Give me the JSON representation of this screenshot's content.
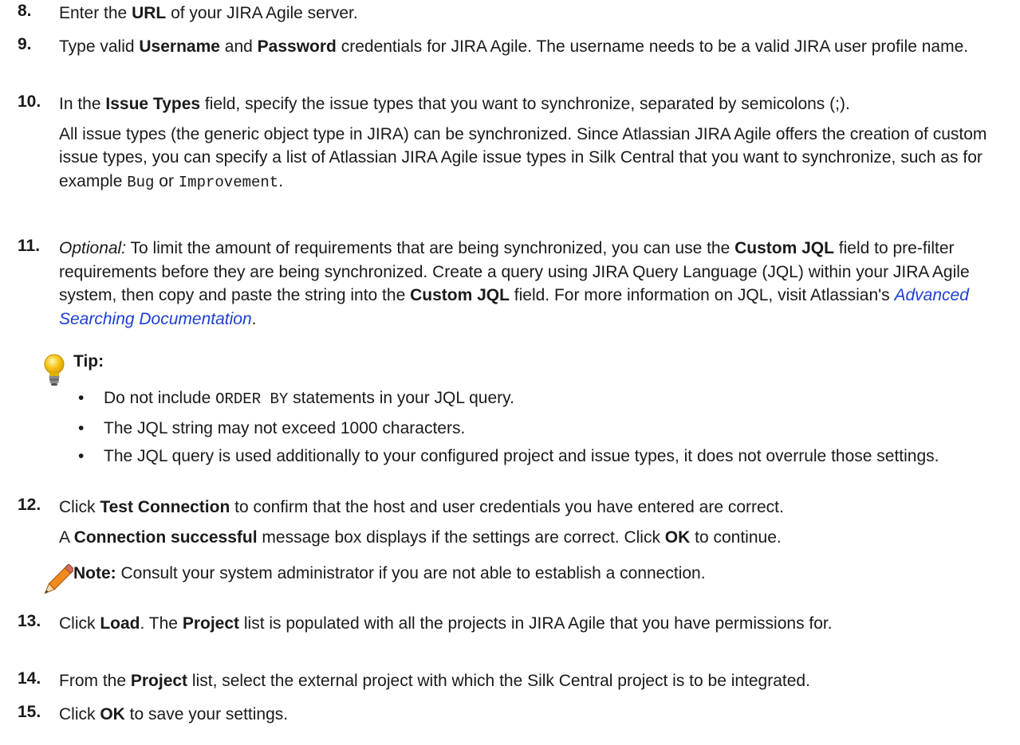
{
  "steps": {
    "s8": {
      "num": "8.",
      "t1": "Enter the ",
      "b1": "URL",
      "t2": " of your JIRA Agile server."
    },
    "s9": {
      "num": "9.",
      "t1": "Type valid ",
      "b1": "Username",
      "t2": " and ",
      "b2": "Password",
      "t3": " credentials for JIRA Agile. The username needs to be a valid JIRA user profile name."
    },
    "s10": {
      "num": "10.",
      "t1": "In the ",
      "b1": "Issue Types",
      "t2": " field, specify the issue types that you want to synchronize, separated by semicolons (;).",
      "p1": "All issue types (the generic object type in JIRA) can be synchronized. Since Atlassian JIRA Agile offers the creation of custom issue types, you can specify a list of Atlassian JIRA Agile issue types in Silk Central that you want to synchronize, such as for example ",
      "c1": "Bug",
      "p2": " or ",
      "c2": "Improvement",
      "p3": "."
    },
    "s11": {
      "num": "11.",
      "i1": "Optional:",
      "t1": " To limit the amount of requirements that are being synchronized, you can use the ",
      "b1": "Custom JQL",
      "t2": " field to pre-filter requirements before they are being synchronized. Create a query using JIRA Query Language (JQL) within your JIRA Agile system, then copy and paste the string into the ",
      "b2": "Custom JQL",
      "t3": " field. For more information on JQL, visit Atlassian's ",
      "link": "Advanced Searching Documentation",
      "t4": "."
    },
    "s12": {
      "num": "12.",
      "t1": "Click ",
      "b1": "Test Connection",
      "t2": " to confirm that the host and user credentials you have entered are correct.",
      "p1": "A ",
      "pb1": "Connection successful",
      "p2": " message box displays if the settings are correct. Click ",
      "pb2": "OK",
      "p3": " to continue."
    },
    "s13": {
      "num": "13.",
      "t1": "Click ",
      "b1": "Load",
      "t2": ". The ",
      "b2": "Project",
      "t3": " list is populated with all the projects in JIRA Agile that you have permissions for."
    },
    "s14": {
      "num": "14.",
      "t1": "From the ",
      "b1": "Project",
      "t2": " list, select the external project with which the Silk Central project is to be integrated."
    },
    "s15": {
      "num": "15.",
      "t1": "Click ",
      "b1": "OK",
      "t2": " to save your settings."
    }
  },
  "tip": {
    "label": "Tip:",
    "bullet1_pre": "Do not include ",
    "bullet1_code": "ORDER BY",
    "bullet1_post": " statements in your JQL query.",
    "bullet2": "The JQL string may not exceed 1000 characters.",
    "bullet3": "The JQL query is used additionally to your configured project and issue types, it does not overrule those settings."
  },
  "note": {
    "label": "Note:",
    "text": " Consult your system administrator if you are not able to establish a connection."
  },
  "colors": {
    "link": "#1c3fd1",
    "bulb": "#f5c518",
    "pencil": "#f08a1c"
  },
  "icons": {
    "tip": "lightbulb-icon",
    "note": "pencil-icon"
  }
}
